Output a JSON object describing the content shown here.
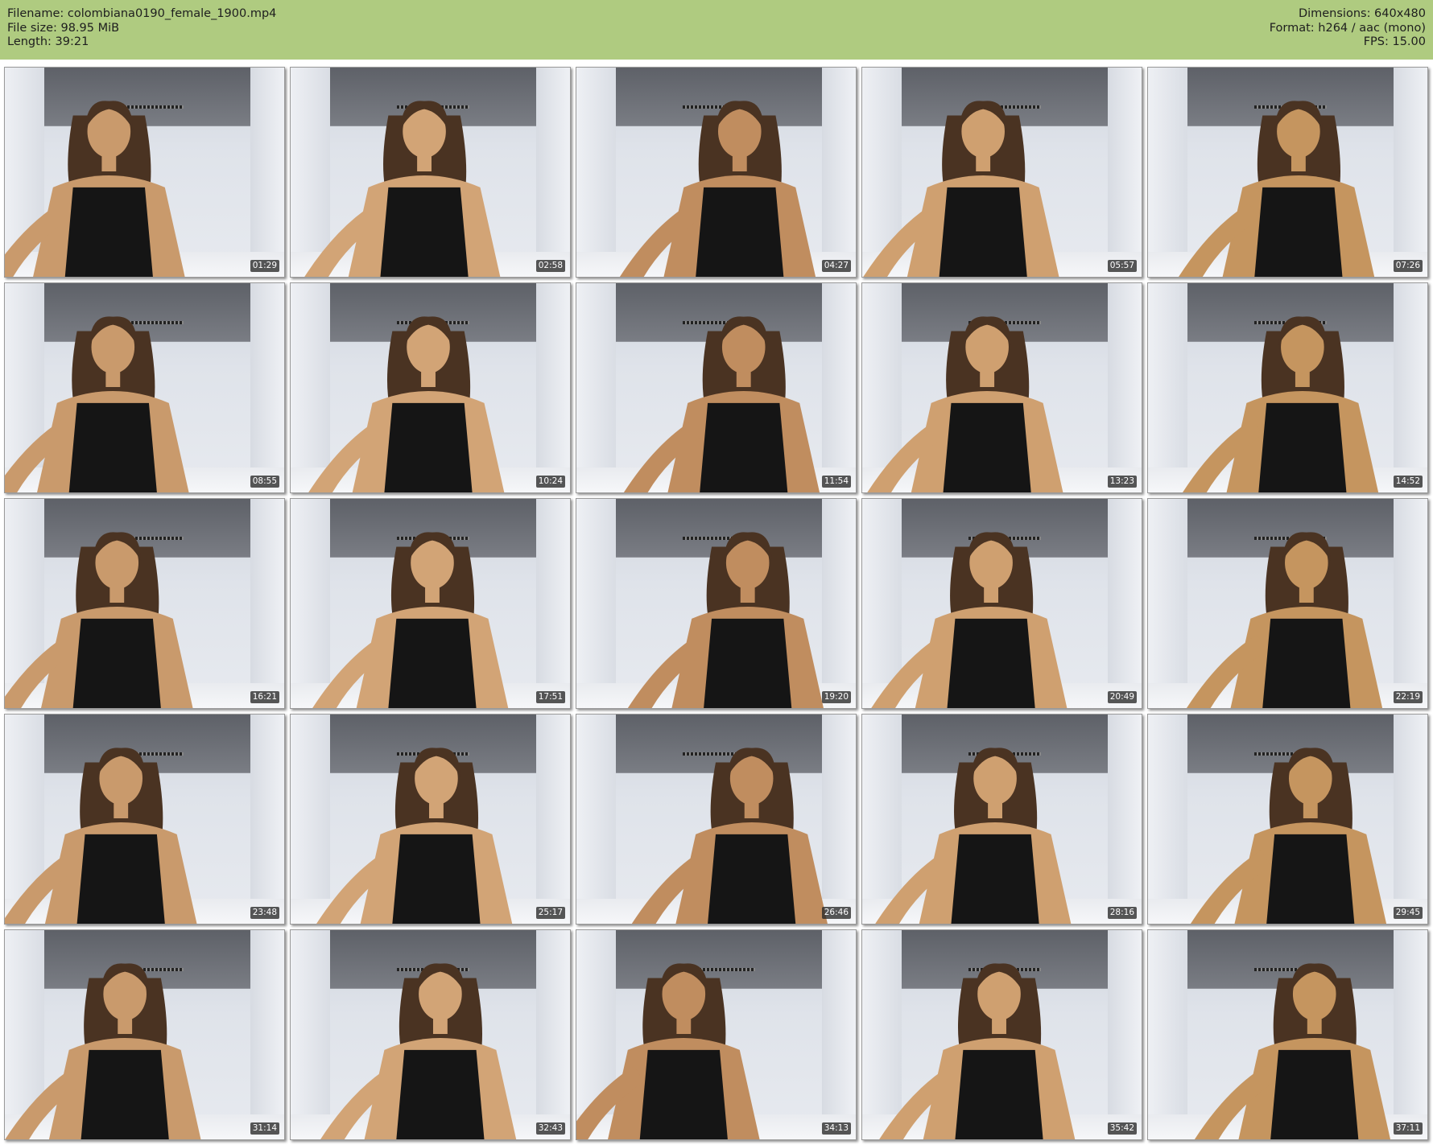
{
  "header": {
    "filename": "Filename: colombiana0190_female_1900.mp4",
    "filesize": "File size: 98.95 MiB",
    "length": "Length: 39:21",
    "dimensions": "Dimensions: 640x480",
    "format": "Format: h264 / aac (mono)",
    "fps": "FPS: 15.00"
  },
  "colors": {
    "header_bg": "#afcb80",
    "timestamp_bg": "#282828"
  },
  "thumbnails": [
    {
      "time": "01:29"
    },
    {
      "time": "02:58"
    },
    {
      "time": "04:27"
    },
    {
      "time": "05:57"
    },
    {
      "time": "07:26"
    },
    {
      "time": "08:55"
    },
    {
      "time": "10:24"
    },
    {
      "time": "11:54"
    },
    {
      "time": "13:23"
    },
    {
      "time": "14:52"
    },
    {
      "time": "16:21"
    },
    {
      "time": "17:51"
    },
    {
      "time": "19:20"
    },
    {
      "time": "20:49"
    },
    {
      "time": "22:19"
    },
    {
      "time": "23:48"
    },
    {
      "time": "25:17"
    },
    {
      "time": "26:46"
    },
    {
      "time": "28:16"
    },
    {
      "time": "29:45"
    },
    {
      "time": "31:14"
    },
    {
      "time": "32:43"
    },
    {
      "time": "34:13"
    },
    {
      "time": "35:42"
    },
    {
      "time": "37:11"
    }
  ]
}
